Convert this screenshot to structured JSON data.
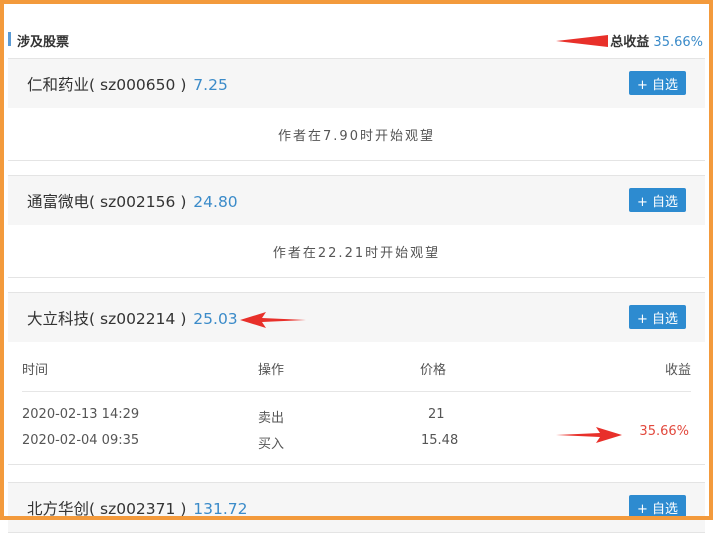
{
  "header": {
    "title": "涉及股票",
    "total_label": "总收益",
    "total_value": "35.66%"
  },
  "stocks": [
    {
      "name": "仁和药业",
      "code": "sz000650",
      "price": "7.25",
      "add_label": "+ 自选",
      "watch_note": "作者在7.90时开始观望"
    },
    {
      "name": "通富微电",
      "code": "sz002156",
      "price": "24.80",
      "add_label": "+ 自选",
      "watch_note": "作者在22.21时开始观望"
    },
    {
      "name": "大立科技",
      "code": "sz002214",
      "price": "25.03",
      "add_label": "+ 自选",
      "trades": {
        "columns": [
          "时间",
          "操作",
          "价格",
          "收益"
        ],
        "rows": [
          {
            "time": "2020-02-13 14:29",
            "action": "卖出",
            "price": "21"
          },
          {
            "time": "2020-02-04 09:35",
            "action": "买入",
            "price": "15.48"
          }
        ],
        "profit": "35.66%"
      }
    },
    {
      "name": "北方华创",
      "code": "sz002371",
      "price": "131.72",
      "add_label": "+ 自选"
    }
  ],
  "colors": {
    "accent": "#3b8bc9",
    "button": "#2d8bd0",
    "profit": "#e2493d",
    "frame": "#f39a3c",
    "annotation_arrow": "#e8302a"
  }
}
